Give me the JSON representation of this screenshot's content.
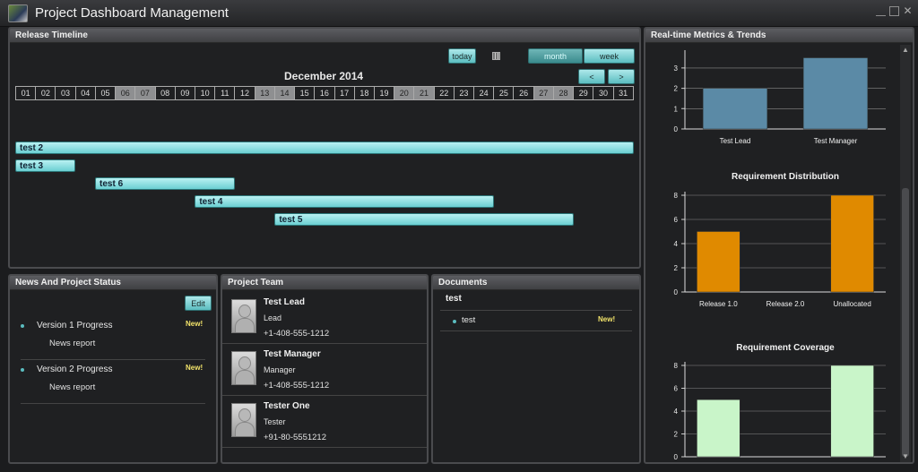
{
  "window": {
    "title": "Project Dashboard Management",
    "minimize_icon": "minimize-icon",
    "maximize_icon": "maximize-icon",
    "close_icon": "close-icon",
    "close_glyph": "✕"
  },
  "timeline": {
    "header": "Release Timeline",
    "today_label": "today",
    "month_label": "month",
    "week_label": "week",
    "prev_label": "<",
    "next_label": ">",
    "title": "December 2014",
    "days": [
      "01",
      "02",
      "03",
      "04",
      "05",
      "06",
      "07",
      "08",
      "09",
      "10",
      "11",
      "12",
      "13",
      "14",
      "15",
      "16",
      "17",
      "18",
      "19",
      "20",
      "21",
      "22",
      "23",
      "24",
      "25",
      "26",
      "27",
      "28",
      "29",
      "30",
      "31"
    ],
    "weekend_days": [
      "06",
      "07",
      "13",
      "14",
      "20",
      "21",
      "27",
      "28"
    ],
    "tasks": [
      {
        "name": "test 2",
        "start_day": 1,
        "end_day": 31
      },
      {
        "name": "test 3",
        "start_day": 1,
        "end_day": 3
      },
      {
        "name": "test 6",
        "start_day": 5,
        "end_day": 11
      },
      {
        "name": "test 4",
        "start_day": 10,
        "end_day": 24
      },
      {
        "name": "test 5",
        "start_day": 14,
        "end_day": 28
      }
    ]
  },
  "metrics": {
    "header": "Real-time Metrics & Trends"
  },
  "chart_data": [
    {
      "type": "bar",
      "title": "",
      "categories": [
        "Test Lead",
        "Test Manager"
      ],
      "values": [
        2,
        3.5
      ],
      "ylim": [
        0,
        3.7
      ],
      "yticks": [
        "0",
        "1",
        "2",
        "3"
      ],
      "color": "#5b8aa6",
      "grid": true
    },
    {
      "type": "bar",
      "title": "Requirement Distribution",
      "categories": [
        "Release 1.0",
        "Release 2.0",
        "Unallocated"
      ],
      "values": [
        5,
        0,
        8
      ],
      "ylim": [
        0,
        8
      ],
      "yticks": [
        "0",
        "2",
        "4",
        "6",
        "8"
      ],
      "color": "#e08a00",
      "grid": true
    },
    {
      "type": "bar",
      "title": "Requirement Coverage",
      "categories": [
        "",
        "",
        ""
      ],
      "values": [
        5,
        0,
        8
      ],
      "ylim": [
        0,
        8
      ],
      "yticks": [
        "0",
        "2",
        "4",
        "6",
        "8"
      ],
      "color": "#c9f5c9",
      "grid": true
    }
  ],
  "news": {
    "header": "News And Project Status",
    "edit_label": "Edit",
    "items": [
      {
        "title": "Version 1 Progress",
        "subtitle": "News report",
        "badge": "New!"
      },
      {
        "title": "Version 2 Progress",
        "subtitle": "News report",
        "badge": "New!"
      }
    ]
  },
  "team": {
    "header": "Project Team",
    "members": [
      {
        "name": "Test Lead",
        "role": "Lead",
        "phone": "+1-408-555-1212"
      },
      {
        "name": "Test Manager",
        "role": "Manager",
        "phone": "+1-408-555-1212"
      },
      {
        "name": "Tester One",
        "role": "Tester",
        "phone": "+91-80-5551212"
      }
    ]
  },
  "documents": {
    "header": "Documents",
    "folder": "test",
    "items": [
      {
        "name": "test",
        "badge": "New!"
      }
    ]
  }
}
